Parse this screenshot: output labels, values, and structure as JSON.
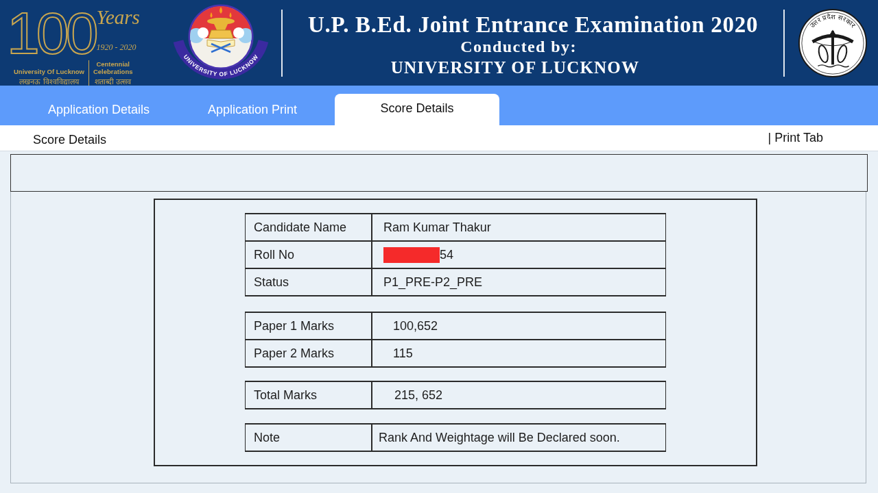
{
  "header": {
    "centenary_emblem": {
      "numeral": "100",
      "years": "Years",
      "year_range": "1920 - 2020",
      "university_en": "University Of Lucknow",
      "university_hi": "लखनऊ विश्वविद्यालय",
      "celebration_en": "Centennial Celebrations",
      "celebration_hi": "शताब्दी उत्सव"
    },
    "university_seal": {
      "ring_text": "UNIVERSITY OF LUCKNOW"
    },
    "title": "U.P. B.Ed. Joint Entrance Examination 2020",
    "subtitle": "Conducted by:",
    "organizer": "UNIVERSITY OF LUCKNOW",
    "state_emblem": {
      "ring_text": "उत्तर प्रदेश सरकार"
    }
  },
  "tabs": [
    {
      "label": "Application Details",
      "selected": false
    },
    {
      "label": "Application Print",
      "selected": false
    },
    {
      "label": "Score Details",
      "selected": true
    }
  ],
  "section_bar": {
    "title": "Score Details",
    "print_link": "| Print Tab"
  },
  "score_tables": [
    {
      "rows": [
        {
          "label": "Candidate Name",
          "value": "Ram Kumar Thakur",
          "redacted": false
        },
        {
          "label": "Roll No",
          "value": "54",
          "redacted": true
        },
        {
          "label": "Status",
          "value": "P1_PRE-P2_PRE",
          "redacted": false
        }
      ]
    },
    {
      "rows": [
        {
          "label": "Paper 1 Marks",
          "value": "100,652",
          "redacted": false
        },
        {
          "label": "Paper 2 Marks",
          "value": "115",
          "redacted": false
        }
      ]
    },
    {
      "rows": [
        {
          "label": "Total Marks",
          "value": "215, 652",
          "redacted": false
        }
      ]
    },
    {
      "rows": [
        {
          "label": "Note",
          "value": "Rank And Weightage will Be Declared soon.",
          "redacted": false
        }
      ]
    }
  ]
}
